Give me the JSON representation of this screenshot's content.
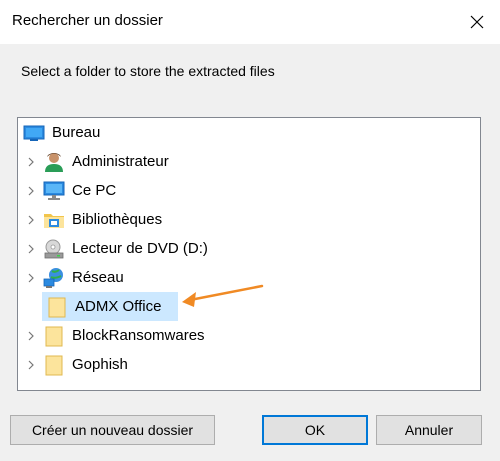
{
  "window": {
    "title": "Rechercher un dossier",
    "close_icon": "close-icon"
  },
  "instruction": "Select a folder to store the extracted files",
  "tree": {
    "root": {
      "label": "Bureau",
      "icon": "desktop-icon"
    },
    "items": [
      {
        "label": "Administrateur",
        "icon": "user-icon",
        "expandable": true
      },
      {
        "label": "Ce PC",
        "icon": "computer-icon",
        "expandable": true
      },
      {
        "label": "Bibliothèques",
        "icon": "library-icon",
        "expandable": true
      },
      {
        "label": "Lecteur de DVD (D:)",
        "icon": "dvd-drive-icon",
        "expandable": true
      },
      {
        "label": "Réseau",
        "icon": "network-icon",
        "expandable": true
      },
      {
        "label": "ADMX Office",
        "icon": "folder-icon",
        "expandable": false,
        "selected": true
      },
      {
        "label": "BlockRansomwares",
        "icon": "folder-icon",
        "expandable": true
      },
      {
        "label": "Gophish",
        "icon": "folder-icon",
        "expandable": true
      }
    ]
  },
  "buttons": {
    "new_folder": "Créer un nouveau dossier",
    "ok": "OK",
    "cancel": "Annuler"
  },
  "colors": {
    "selection": "#cce8ff",
    "default_button_border": "#0078d7",
    "annotation_arrow": "#f08a24",
    "folder": "#fce49c"
  }
}
